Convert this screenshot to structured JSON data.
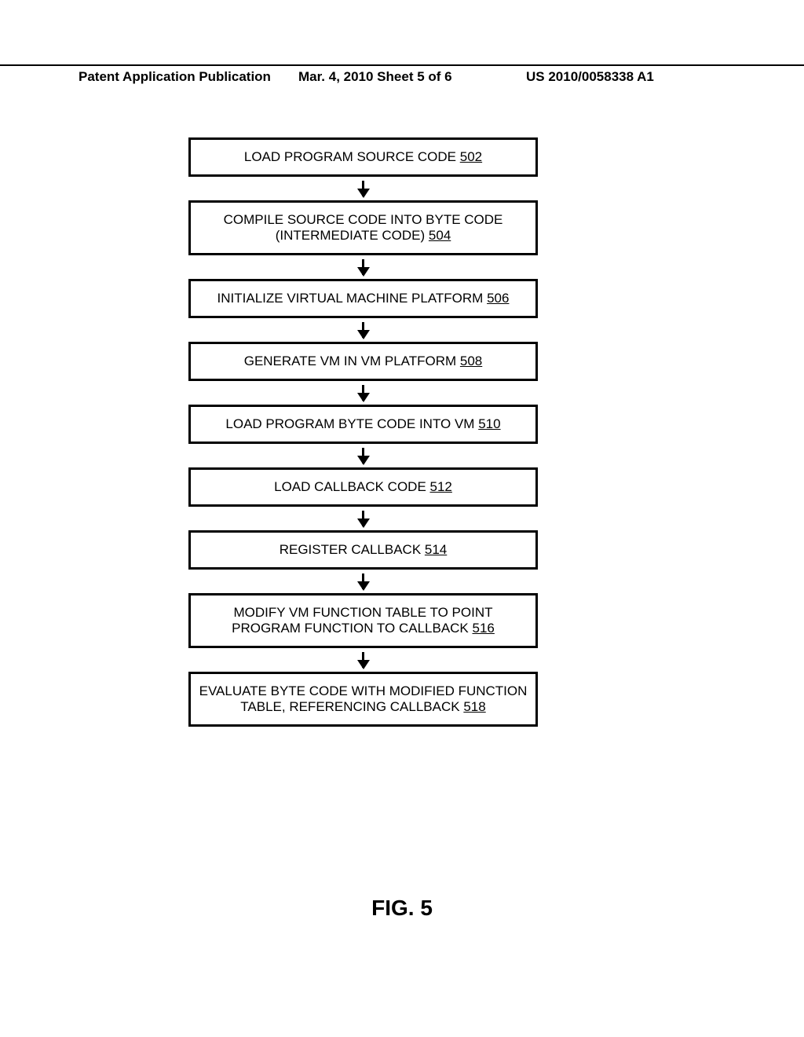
{
  "header": {
    "left": "Patent Application Publication",
    "center": "Mar. 4, 2010  Sheet 5 of 6",
    "right": "US 2010/0058338 A1"
  },
  "figure_label": "FIG. 5",
  "steps": [
    {
      "text": "LOAD PROGRAM SOURCE CODE ",
      "ref": "502"
    },
    {
      "text": "COMPILE SOURCE CODE INTO BYTE CODE (INTERMEDIATE CODE) ",
      "ref": "504"
    },
    {
      "text": "INITIALIZE VIRTUAL MACHINE PLATFORM ",
      "ref": "506"
    },
    {
      "text": "GENERATE VM IN VM PLATFORM ",
      "ref": "508"
    },
    {
      "text": "LOAD PROGRAM BYTE CODE INTO VM ",
      "ref": "510"
    },
    {
      "text": "LOAD CALLBACK CODE ",
      "ref": "512"
    },
    {
      "text": "REGISTER CALLBACK ",
      "ref": "514"
    },
    {
      "text": "MODIFY VM FUNCTION TABLE TO POINT PROGRAM FUNCTION TO CALLBACK ",
      "ref": "516"
    },
    {
      "text": "EVALUATE BYTE CODE WITH MODIFIED FUNCTION TABLE, REFERENCING CALLBACK ",
      "ref": "518"
    }
  ]
}
